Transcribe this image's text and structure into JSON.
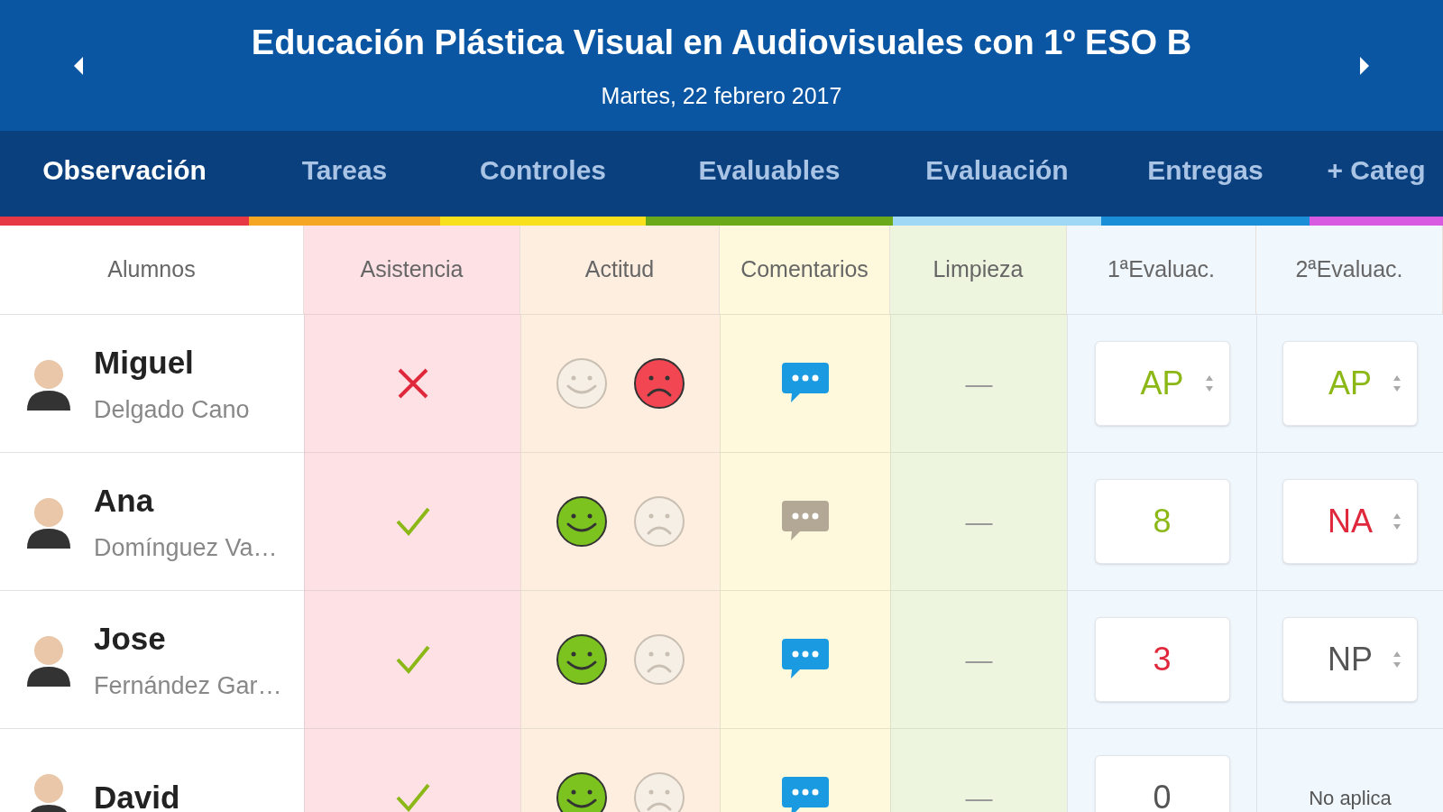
{
  "header": {
    "title": "Educación Plástica Visual en Audiovisuales con 1º ESO B",
    "date": "Martes, 22 febrero 2017"
  },
  "tabs": [
    {
      "label": "Observación",
      "selected": true,
      "color": "#e53844"
    },
    {
      "label": "Tareas",
      "selected": false,
      "color": "#f5a623"
    },
    {
      "label": "Controles",
      "selected": false,
      "color": "#f8e11c"
    },
    {
      "label": "Evaluables",
      "selected": false,
      "color": "#6aa919"
    },
    {
      "label": "Evaluación",
      "selected": false,
      "color": "#9ed8f5"
    },
    {
      "label": "Entregas",
      "selected": false,
      "color": "#1a8fd8"
    },
    {
      "label": "+ Categ",
      "selected": false,
      "color": "#d85ae0"
    }
  ],
  "columns": [
    "Alumnos",
    "Asistencia",
    "Actitud",
    "Comentarios",
    "Limpieza",
    "1ªEvaluac.",
    "2ªEvaluac."
  ],
  "rows": [
    {
      "first_name": "Miguel",
      "last_name": "Delgado Cano",
      "present": false,
      "attitude_positive": false,
      "attitude_negative": true,
      "has_comment": true,
      "cleanliness": "—",
      "eval_1": {
        "value": "AP",
        "kind": "select",
        "color": "#8cb817"
      },
      "eval_2": {
        "value": "AP",
        "kind": "select",
        "color": "#8cb817"
      }
    },
    {
      "first_name": "Ana",
      "last_name": "Domínguez Va…",
      "present": true,
      "attitude_positive": true,
      "attitude_negative": false,
      "has_comment": false,
      "cleanliness": "—",
      "eval_1": {
        "value": "8",
        "kind": "number",
        "color": "#8cb817"
      },
      "eval_2": {
        "value": "NA",
        "kind": "select",
        "color": "#e0283d"
      }
    },
    {
      "first_name": "Jose",
      "last_name": "Fernández Gar…",
      "present": true,
      "attitude_positive": true,
      "attitude_negative": false,
      "has_comment": true,
      "cleanliness": "—",
      "eval_1": {
        "value": "3",
        "kind": "number",
        "color": "#e0283d"
      },
      "eval_2": {
        "value": "NP",
        "kind": "select",
        "color": "#555555"
      }
    },
    {
      "first_name": "David",
      "present": true,
      "attitude_positive": true,
      "attitude_negative": false,
      "has_comment": true,
      "cleanliness": "—",
      "eval_1": {
        "value": "0",
        "kind": "number",
        "color": "#555555"
      },
      "eval_2": {
        "value": "No aplica",
        "kind": "text",
        "color": "#555555"
      }
    }
  ]
}
